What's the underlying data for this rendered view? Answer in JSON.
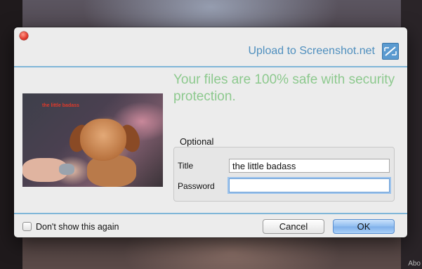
{
  "brand": {
    "title": "Upload to Screenshot.net",
    "icon": "screenshot-net-logo-icon"
  },
  "headline": "Your files are 100% safe with security protection.",
  "thumbnail": {
    "caption": "the little badass"
  },
  "optional": {
    "group_label": "Optional",
    "title_label": "Title",
    "title_value": "the little badass",
    "password_label": "Password",
    "password_value": ""
  },
  "footer": {
    "dont_show_label": "Don't show this again",
    "dont_show_checked": false,
    "cancel_label": "Cancel",
    "ok_label": "OK"
  },
  "background": {
    "about_text": "Abo"
  },
  "colors": {
    "brand_blue": "#4f8fbe",
    "headline_green": "#8dc98e",
    "rule_blue": "#7fb6d8"
  }
}
